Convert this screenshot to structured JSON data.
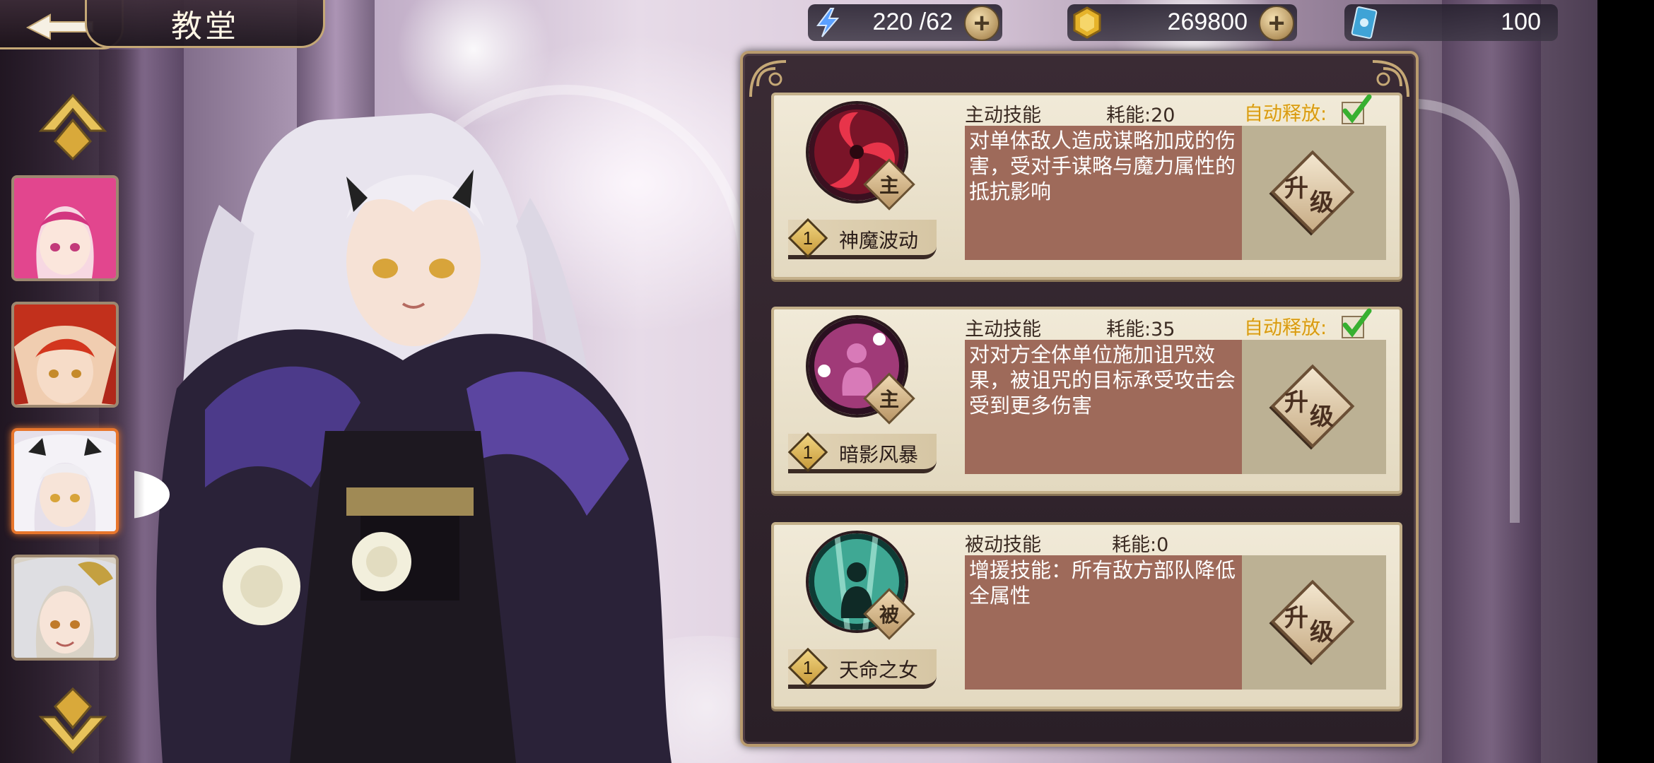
{
  "header": {
    "title": "教堂"
  },
  "resources": {
    "energy": {
      "value": "220 /62",
      "icon": "lightning-icon",
      "color": "#5aa0ff"
    },
    "gold": {
      "value": "269800",
      "icon": "gold-coin-icon",
      "color": "#e6b32a"
    },
    "tickets": {
      "value": "100",
      "icon": "card-ticket-icon",
      "color": "#3fa3d6"
    }
  },
  "heroes": [
    {
      "name": "pink-hair-hero",
      "selected": false
    },
    {
      "name": "red-hair-hero",
      "selected": false
    },
    {
      "name": "white-hair-hero",
      "selected": true
    },
    {
      "name": "silver-hair-hero",
      "selected": false
    }
  ],
  "skills": [
    {
      "type": "主动技能",
      "cost": "耗能:20",
      "auto_cast": "自动释放:",
      "badge": "主",
      "level": "1",
      "name": "神魔波动",
      "description": "对单体敌人造成谋略加成的伤害，受对手谋略与魔力属性的抵抗影响",
      "upgrade_l1": "升",
      "upgrade_l2": "级"
    },
    {
      "type": "主动技能",
      "cost": "耗能:35",
      "auto_cast": "自动释放:",
      "badge": "主",
      "level": "1",
      "name": "暗影风暴",
      "description": "对对方全体单位施加诅咒效果，被诅咒的目标承受攻击会受到更多伤害",
      "upgrade_l1": "升",
      "upgrade_l2": "级"
    },
    {
      "type": "被动技能",
      "cost": "耗能:0",
      "badge": "被",
      "level": "1",
      "name": "天命之女",
      "description": "增援技能：所有敌方部队降低全属性",
      "upgrade_l1": "升",
      "upgrade_l2": "级"
    }
  ],
  "colors": {
    "accent_gold": "#c5a876",
    "selected_border": "#e8762c",
    "desc_box": "#9e6a5a",
    "auto_cast_text": "#d99a12"
  }
}
